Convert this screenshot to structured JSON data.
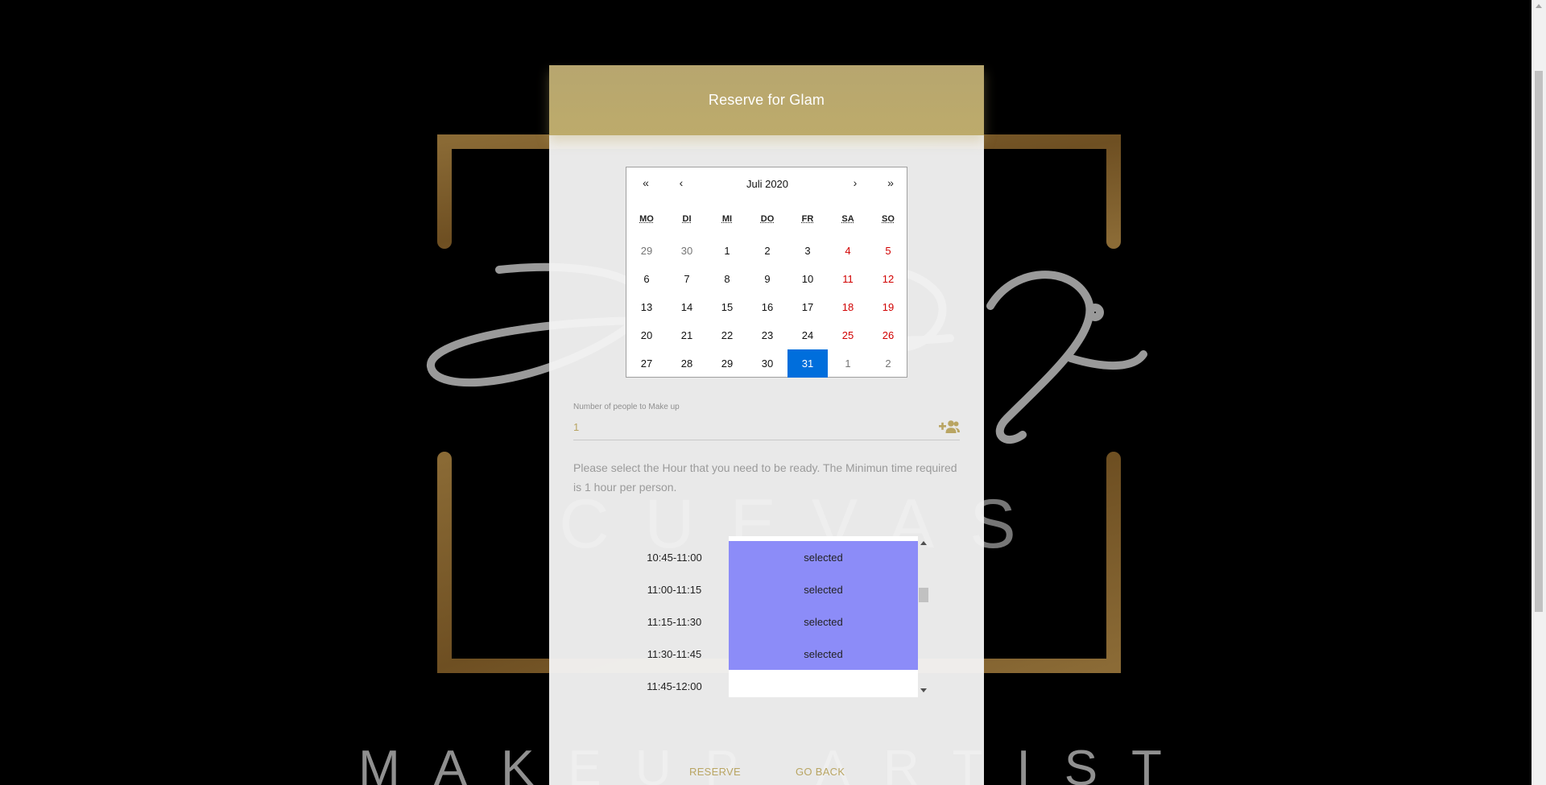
{
  "card": {
    "title": "Reserve for Glam"
  },
  "calendar": {
    "nav": {
      "prev_year": "«",
      "prev_month": "‹",
      "next_month": "›",
      "next_year": "»"
    },
    "month_label": "Juli 2020",
    "weekdays": [
      "MO",
      "DI",
      "MI",
      "DO",
      "FR",
      "SA",
      "SO"
    ],
    "weeks": [
      [
        "29",
        "30",
        "1",
        "2",
        "3",
        "4",
        "5"
      ],
      [
        "6",
        "7",
        "8",
        "9",
        "10",
        "11",
        "12"
      ],
      [
        "13",
        "14",
        "15",
        "16",
        "17",
        "18",
        "19"
      ],
      [
        "20",
        "21",
        "22",
        "23",
        "24",
        "25",
        "26"
      ],
      [
        "27",
        "28",
        "29",
        "30",
        "31",
        "1",
        "2"
      ]
    ],
    "selected_day": "31"
  },
  "people_field": {
    "label": "Number of people to Make up",
    "value": "1",
    "icon": "add-person-icon"
  },
  "help_text": "Please select the Hour that you need to be ready. The Minimun time required is 1 hour per person.",
  "slots": [
    {
      "time": "10:45-11:00",
      "status": "selected"
    },
    {
      "time": "11:00-11:15",
      "status": "selected"
    },
    {
      "time": "11:15-11:30",
      "status": "selected"
    },
    {
      "time": "11:30-11:45",
      "status": "selected"
    },
    {
      "time": "11:45-12:00",
      "status": ""
    }
  ],
  "actions": {
    "reserve": "RESERVE",
    "go_back": "GO BACK"
  },
  "colors": {
    "header_gold": "#bdab6b",
    "accent_gold": "#b9a563",
    "selected_day": "#006edc",
    "selected_slot": "#8c8cf8",
    "weekend_red": "#d10000"
  }
}
